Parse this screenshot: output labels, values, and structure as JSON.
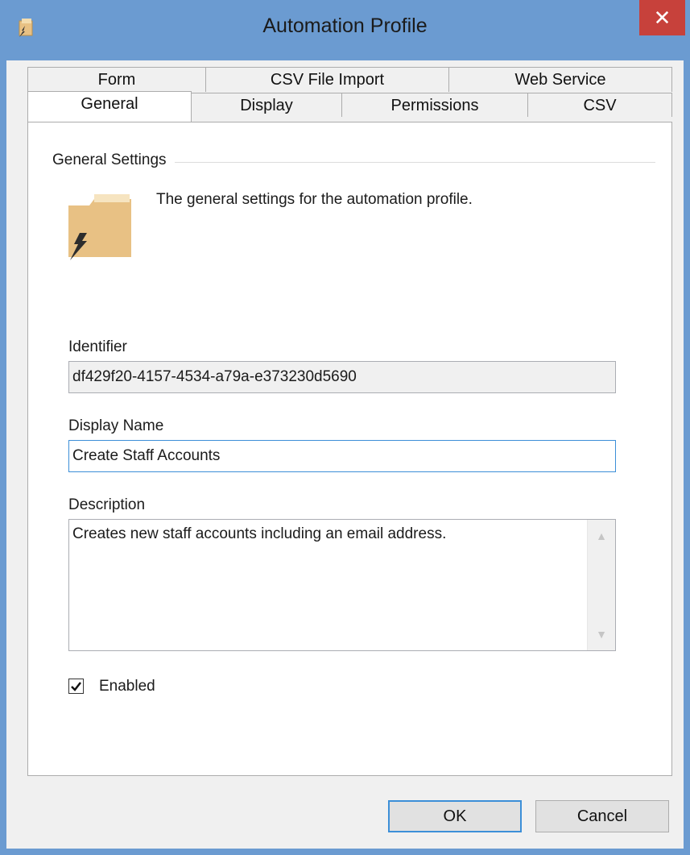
{
  "window": {
    "title": "Automation Profile",
    "close_label": "✕"
  },
  "tabs": {
    "row1": [
      {
        "label": "Form"
      },
      {
        "label": "CSV File Import"
      },
      {
        "label": "Web Service"
      }
    ],
    "row2": [
      {
        "label": "General",
        "active": true
      },
      {
        "label": "Display"
      },
      {
        "label": "Permissions"
      },
      {
        "label": "CSV"
      }
    ]
  },
  "general": {
    "group_title": "General Settings",
    "description_text": "The general settings for the automation profile.",
    "identifier_label": "Identifier",
    "identifier_value": "df429f20-4157-4534-a79a-e373230d5690",
    "display_name_label": "Display Name",
    "display_name_value": "Create Staff Accounts",
    "description_label": "Description",
    "description_value": "Creates new staff accounts including an email address.",
    "enabled_label": "Enabled",
    "enabled_checked": true
  },
  "buttons": {
    "ok": "OK",
    "cancel": "Cancel"
  },
  "colors": {
    "titlebar": "#6b9bd1",
    "close": "#c7413b",
    "focus": "#3c8fd8",
    "folder": "#e8c184"
  }
}
